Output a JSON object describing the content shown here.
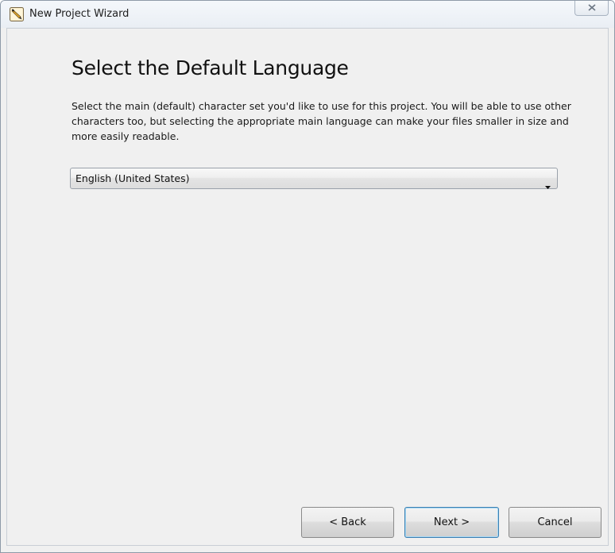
{
  "window": {
    "title": "New Project Wizard",
    "app_icon": "wizard-pencil-icon",
    "close_icon": "close-icon"
  },
  "page": {
    "heading": "Select the Default Language",
    "description": "Select the main (default) character set you'd like to use for this project. You will be able to use other characters too, but selecting the appropriate main language can make your files smaller in size and more easily readable."
  },
  "language_select": {
    "selected": "English (United States)",
    "arrow_icon": "dropdown-arrow-icon"
  },
  "buttons": {
    "back": "< Back",
    "next": "Next >",
    "cancel": "Cancel"
  },
  "colors": {
    "default_button_border": "#3c7fb1",
    "window_background": "#f0f0f0"
  }
}
